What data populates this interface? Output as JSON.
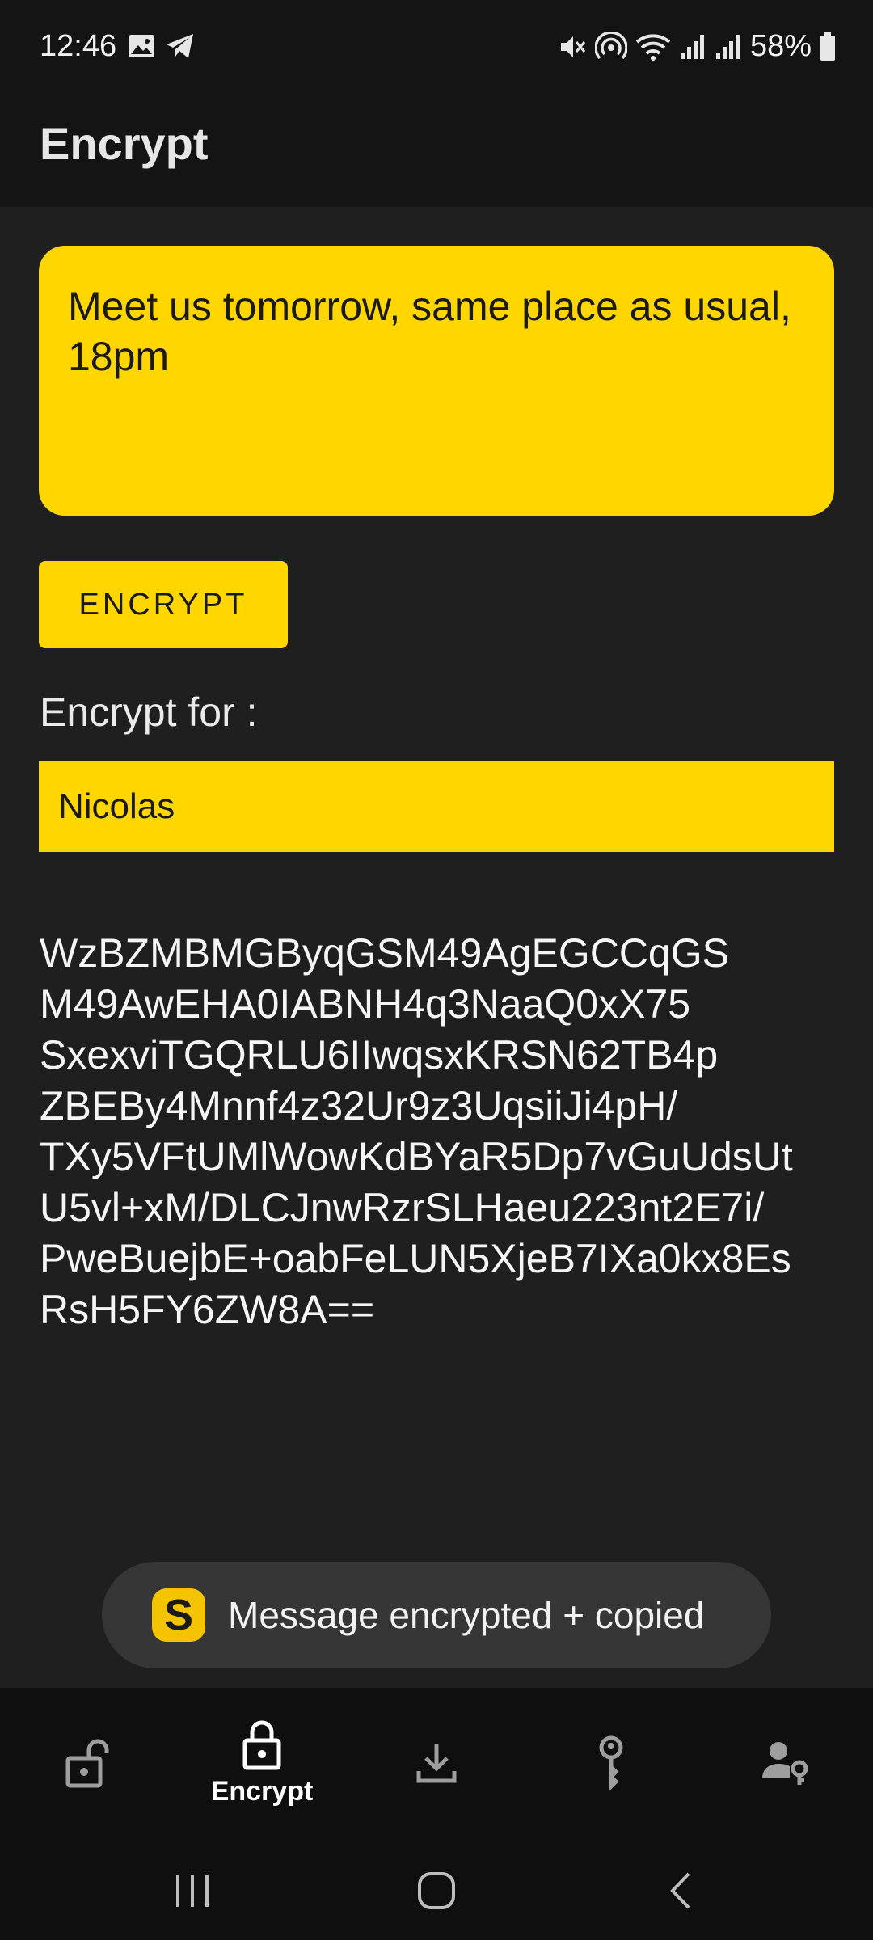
{
  "status_bar": {
    "time": "12:46",
    "battery": "58%"
  },
  "app_bar": {
    "title": "Encrypt"
  },
  "message": {
    "value": "Meet us tomorrow, same place as usual, 18pm"
  },
  "encrypt_button": {
    "label": "ENCRYPT"
  },
  "recipient": {
    "label": "Encrypt for :",
    "selected": "Nicolas"
  },
  "cipher": {
    "text": "WzBZMBMGByqGSM49AgEGCCqGS\nM49AwEHA0IABNH4q3NaaQ0xX75\nSxexviTGQRLU6IIwqsxKRSN62TB4p\nZBEBy4Mnnf4z32Ur9z3UqsiiJi4pH/\nTXy5VFtUMlWowKdBYaR5Dp7vGuUdsUt\nU5vl+xM/DLCJnwRzrSLHaeu223nt2E7i/\nPweBuejbE+oabFeLUN5XjeB7IXa0kx8Es\nRsH5FY6ZW8A=="
  },
  "toast": {
    "logo_letter": "S",
    "text": "Message encrypted + copied"
  },
  "bottom_nav": {
    "items": [
      {
        "icon": "unlock-icon",
        "label": ""
      },
      {
        "icon": "lock-icon",
        "label": "Encrypt"
      },
      {
        "icon": "download-icon",
        "label": ""
      },
      {
        "icon": "key-icon",
        "label": ""
      },
      {
        "icon": "contact-key-icon",
        "label": ""
      }
    ],
    "active_color": "#ffffff",
    "inactive_color": "#9e9e9e"
  },
  "colors": {
    "accent": "#ffd600",
    "background": "#1f1f1f",
    "bar": "#141414"
  }
}
